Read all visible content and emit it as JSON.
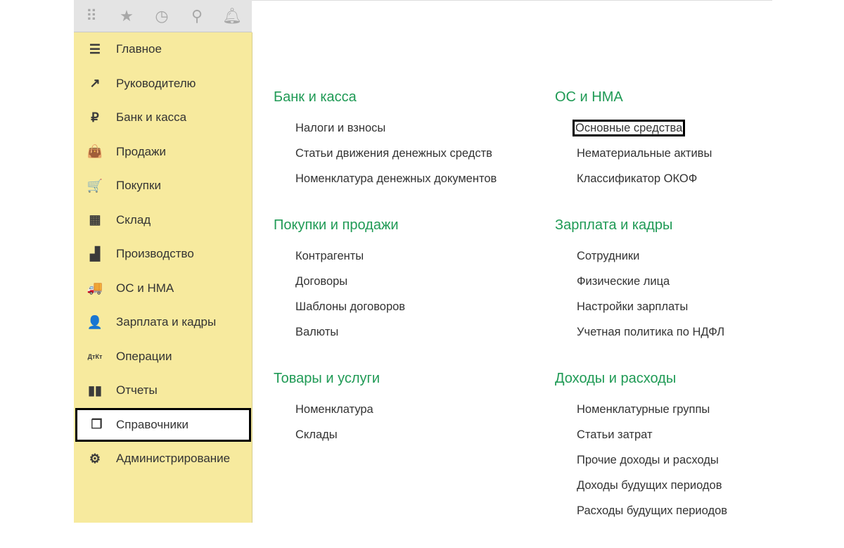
{
  "toolbar": {
    "icons": [
      "apps-grid-icon",
      "star-icon",
      "history-icon",
      "search-icon",
      "bell-icon"
    ]
  },
  "sidebar": {
    "items": [
      {
        "label": "Главное",
        "icon": "menu-icon",
        "glyph": "☰"
      },
      {
        "label": "Руководителю",
        "icon": "trend-icon",
        "glyph": "↗"
      },
      {
        "label": "Банк и касса",
        "icon": "ruble-icon",
        "glyph": "₽"
      },
      {
        "label": "Продажи",
        "icon": "bag-icon",
        "glyph": "👜"
      },
      {
        "label": "Покупки",
        "icon": "cart-icon",
        "glyph": "🛒"
      },
      {
        "label": "Склад",
        "icon": "warehouse-icon",
        "glyph": "▦"
      },
      {
        "label": "Производство",
        "icon": "factory-icon",
        "glyph": "▟"
      },
      {
        "label": "ОС и НМА",
        "icon": "truck-icon",
        "glyph": "🚚"
      },
      {
        "label": "Зарплата и кадры",
        "icon": "person-icon",
        "glyph": "👤"
      },
      {
        "label": "Операции",
        "icon": "dt-kt-icon",
        "glyph": "ДтКт"
      },
      {
        "label": "Отчеты",
        "icon": "bar-chart-icon",
        "glyph": "▮▮"
      },
      {
        "label": "Справочники",
        "icon": "books-icon",
        "glyph": "❐"
      },
      {
        "label": "Администрирование",
        "icon": "gear-icon",
        "glyph": "⚙"
      }
    ],
    "active": "Справочники"
  },
  "main": {
    "left": [
      {
        "title": "Банк и касса",
        "links": [
          "Налоги и взносы",
          "Статьи движения денежных средств",
          "Номенклатура денежных документов"
        ]
      },
      {
        "title": "Покупки и продажи",
        "links": [
          "Контрагенты",
          "Договоры",
          "Шаблоны договоров",
          "Валюты"
        ]
      },
      {
        "title": "Товары и услуги",
        "links": [
          "Номенклатура",
          "Склады"
        ]
      }
    ],
    "right": [
      {
        "title": "ОС и НМА",
        "links": [
          "Основные средства",
          "Нематериальные активы",
          "Классификатор ОКОФ"
        ]
      },
      {
        "title": "Зарплата и кадры",
        "links": [
          "Сотрудники",
          "Физические лица",
          "Настройки зарплаты",
          "Учетная политика по НДФЛ"
        ]
      },
      {
        "title": "Доходы и расходы",
        "links": [
          "Номенклатурные группы",
          "Статьи затрат",
          "Прочие доходы и расходы",
          "Доходы будущих периодов",
          "Расходы будущих периодов"
        ]
      }
    ],
    "highlighted_link": "Основные средства"
  },
  "colors": {
    "sidebar": "#f7ea9e",
    "section_title": "#1f9a55",
    "toolbar": "#e4e4e4"
  }
}
